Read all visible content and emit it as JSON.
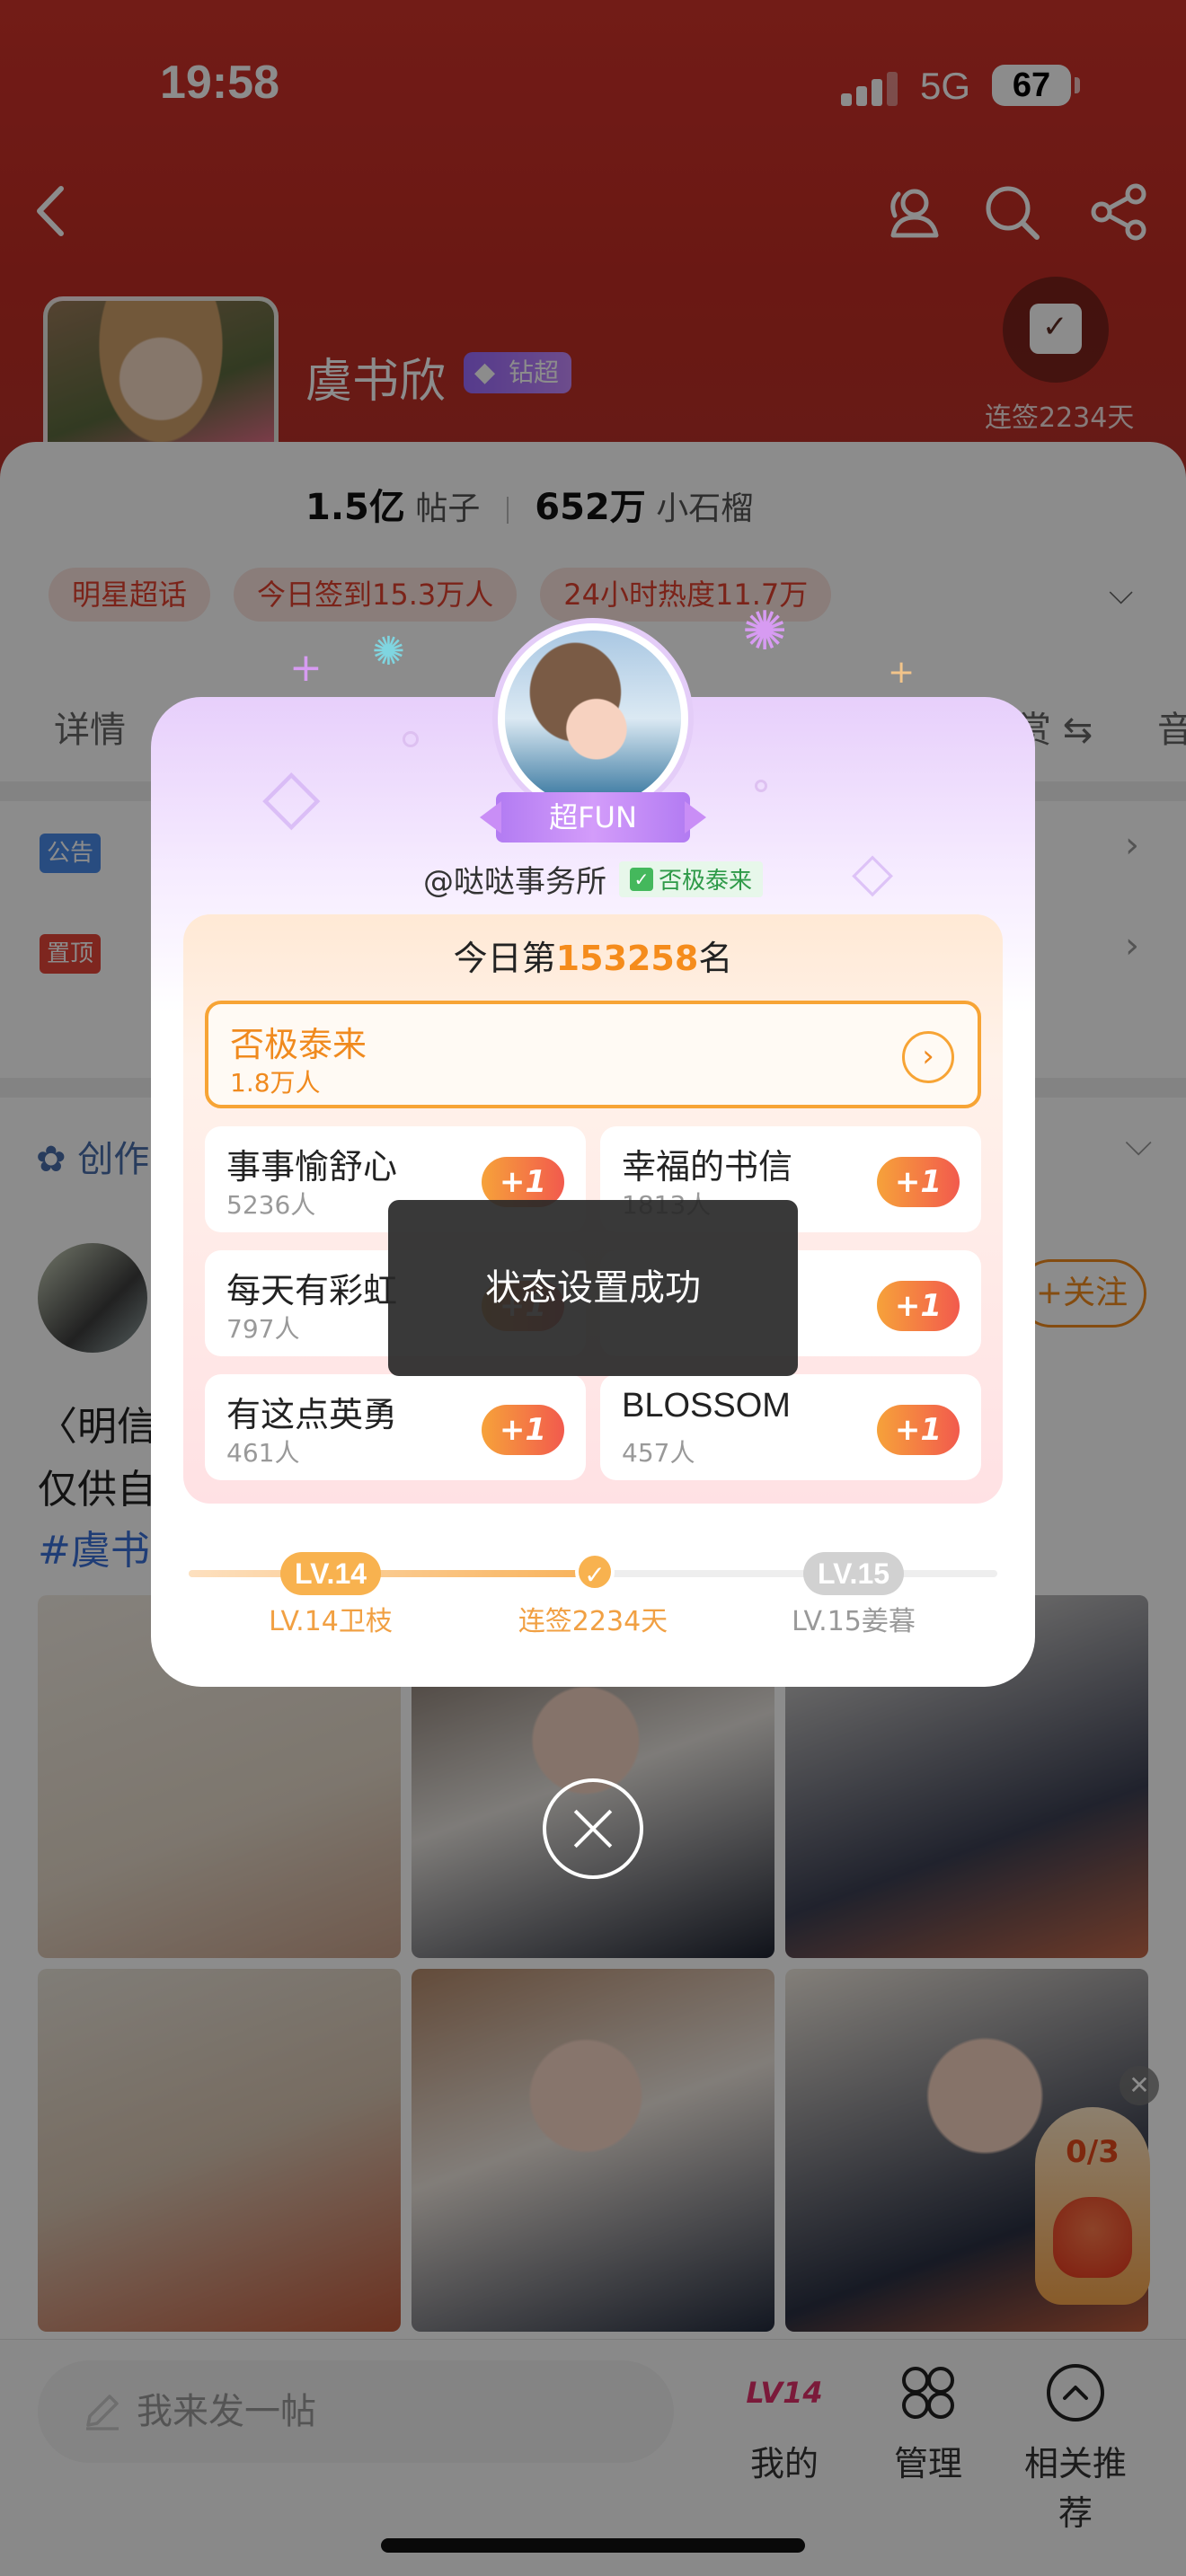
{
  "status_bar": {
    "time": "19:58",
    "network": "5G",
    "battery": "67"
  },
  "header": {
    "star_name": "虞书欣",
    "vip_tag": "钻超",
    "checkin_days_label": "连签2234天",
    "posts_count": "1.5亿",
    "posts_label": "帖子",
    "fans_count": "652万",
    "fans_label": "小石榴"
  },
  "tags": [
    {
      "label": "明星超话"
    },
    {
      "label": "今日签到15.3万人"
    },
    {
      "label": "24小时热度11.7万"
    }
  ],
  "tabs": {
    "detail": "详情",
    "shang": "赏",
    "yin": "音"
  },
  "notices": {
    "announcement": "公告",
    "pinned": "置顶"
  },
  "creator_label": "创作",
  "post": {
    "follow_label": "+关注",
    "text_lines": [
      "〈明信片",
      "仅供自"
    ],
    "hashtag": "#虞书"
  },
  "lucky_bag": {
    "count": "0/3"
  },
  "bottom_bar": {
    "post_placeholder": "我来发一帖",
    "mine_badge": "LV14",
    "mine_label": "我的",
    "manage_label": "管理",
    "recommend_label": "相关推荐"
  },
  "modal": {
    "badge": "超FUN",
    "username": "@哒哒事务所",
    "user_status": "否极泰来",
    "rank_prefix": "今日第",
    "rank_number": "153258",
    "rank_suffix": "名",
    "selected_status": {
      "name": "否极泰来",
      "count": "1.8万人"
    },
    "statuses": [
      {
        "name": "事事愉舒心",
        "count": "5236人",
        "action": "+1"
      },
      {
        "name": "幸福的书信",
        "count": "1813人",
        "action": "+1"
      },
      {
        "name": "每天有彩虹",
        "count": "797人",
        "action": "+1"
      },
      {
        "name": "",
        "count": "",
        "action": "+1"
      },
      {
        "name": "有这点英勇",
        "count": "461人",
        "action": "+1"
      },
      {
        "name": "BLOSSOM",
        "count": "457人",
        "action": "+1"
      }
    ],
    "level": {
      "current_chip": "LV.14",
      "next_chip": "LV.15",
      "current_label": "LV.14卫枝",
      "middle_label": "连签2234天",
      "next_label": "LV.15姜暮",
      "progress": 0.5
    },
    "toast": "状态设置成功"
  },
  "colors": {
    "accent_orange": "#f08a1e",
    "hero_red": "#c8302a",
    "purple": "#b27bf2"
  }
}
